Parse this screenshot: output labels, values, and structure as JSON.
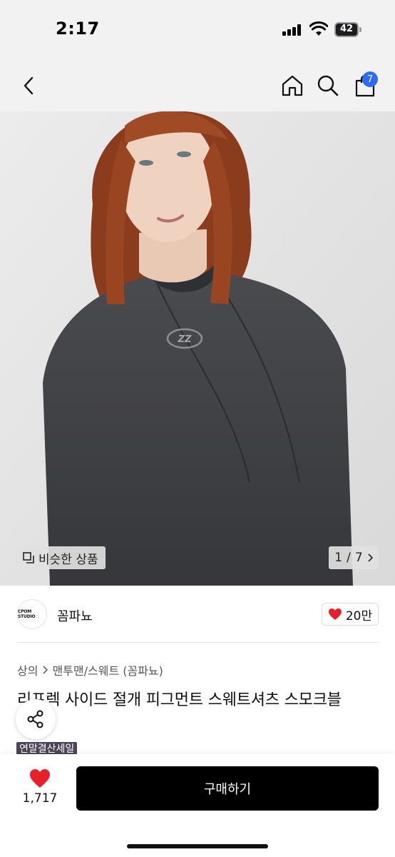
{
  "status_bar": {
    "time": "2:17",
    "battery": "42"
  },
  "nav": {
    "cart_count": "7",
    "icons": [
      "chevron-left-icon",
      "home-icon",
      "search-icon",
      "bag-icon"
    ]
  },
  "gallery": {
    "similar_label": "비슷한 상품",
    "current": "1",
    "separator": "/",
    "total": "7",
    "logo_mark": "ZZ"
  },
  "brand": {
    "logo_text": "CPOM STUDIO",
    "name": "꼼파뇨",
    "likes": "20만"
  },
  "breadcrumb": {
    "category": "상의",
    "subcategory": "맨투맨/스웨트 (꼼파뇨)"
  },
  "product": {
    "title": "리프렉 사이드 절개 피그먼트 스웨트셔츠 스모크블",
    "badge": "연말결산세일"
  },
  "bottom_bar": {
    "wish_count": "1,717",
    "buy_label": "구매하기"
  },
  "colors": {
    "accent_blue": "#2e6bf0",
    "heart_red": "#e8202a",
    "buy_black": "#000000",
    "badge_purple": "#4b4459"
  }
}
